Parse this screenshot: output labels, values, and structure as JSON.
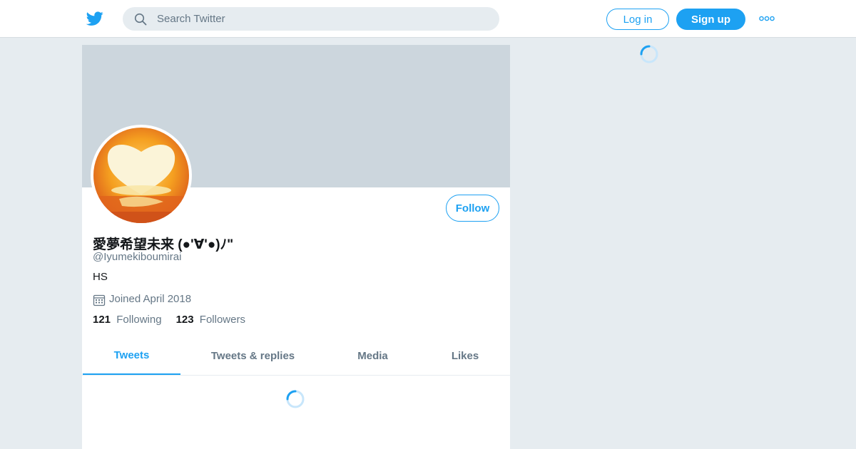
{
  "header": {
    "search_placeholder": "Search Twitter",
    "login_label": "Log in",
    "signup_label": "Sign up"
  },
  "profile": {
    "display_name": "愛夢希望未来 (●'∀'●)ﾉ\"",
    "handle": "@Iyumekiboumirai",
    "bio": "HS",
    "joined": "Joined April 2018",
    "follow_label": "Follow",
    "following_count": "121",
    "following_label": "Following",
    "followers_count": "123",
    "followers_label": "Followers"
  },
  "tabs": [
    {
      "label": "Tweets",
      "active": true
    },
    {
      "label": "Tweets & replies",
      "active": false
    },
    {
      "label": "Media",
      "active": false
    },
    {
      "label": "Likes",
      "active": false
    }
  ],
  "icons": {
    "logo": "twitter-bird-icon",
    "search": "search-icon",
    "more": "more-options-icon",
    "joined": "calendar-icon",
    "loading": "loading-spinner-icon"
  },
  "colors": {
    "accent": "#1da1f2",
    "background": "#e6ecf0",
    "banner": "#ccd6dd",
    "muted_text": "#657786"
  }
}
